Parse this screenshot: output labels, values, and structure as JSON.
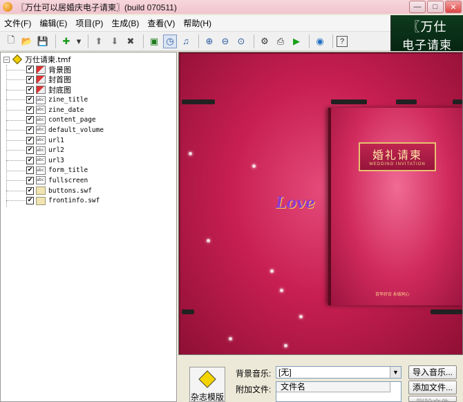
{
  "window": {
    "title": "〖万仕可以居婚庆电子请柬〗(build 070511)",
    "min_label": "—",
    "max_label": "□",
    "close_label": "✕"
  },
  "menu": [
    "文件(F)",
    "编辑(E)",
    "项目(P)",
    "生成(B)",
    "查看(V)",
    "帮助(H)"
  ],
  "brand": {
    "line1": "〖万仕",
    "line2": "电子请柬"
  },
  "toolbar": {
    "icons": [
      "new-file-icon",
      "open-folder-icon",
      "save-icon",
      "add-icon",
      "dropdown-icon",
      "move-up-icon",
      "move-down-icon",
      "delete-icon",
      "export-icon",
      "clock-icon",
      "music-icon",
      "zoom-in-icon",
      "zoom-out-icon",
      "zoom-fit-icon",
      "build-icon",
      "publish-icon",
      "play-icon",
      "web-icon",
      "help-icon"
    ],
    "glyphs": [
      "🗋",
      "📂",
      "💾",
      "✚",
      "▾",
      "⬆",
      "⬇",
      "✖",
      "▣",
      "◷",
      "♫",
      "⊕",
      "⊖",
      "⊙",
      "⚙",
      "⎙",
      "▶",
      "◉",
      "?"
    ]
  },
  "tree": {
    "root": "万仕请柬.tmf",
    "items": [
      {
        "label": "背景图",
        "type": "img",
        "zh": true
      },
      {
        "label": "封首图",
        "type": "img",
        "zh": true
      },
      {
        "label": "封底图",
        "type": "img",
        "zh": true
      },
      {
        "label": "zine_title",
        "type": "txt"
      },
      {
        "label": "zine_date",
        "type": "txt"
      },
      {
        "label": "content_page",
        "type": "txt"
      },
      {
        "label": "default_volume",
        "type": "txt"
      },
      {
        "label": "url1",
        "type": "txt"
      },
      {
        "label": "url2",
        "type": "txt"
      },
      {
        "label": "url3",
        "type": "txt"
      },
      {
        "label": "form_title",
        "type": "txt"
      },
      {
        "label": "fullscreen",
        "type": "txt"
      },
      {
        "label": "buttons.swf",
        "type": "swf"
      },
      {
        "label": "frontinfo.swf",
        "type": "swf"
      }
    ],
    "check_mark": "✔"
  },
  "preview": {
    "book_title_zh": "婚礼请柬",
    "book_title_en": "WEDDING INVITATION",
    "book_footer": "百年好合 永结同心",
    "love_text": "Love"
  },
  "bottom": {
    "magazine_label": "杂志模版",
    "bg_music_label": "背景音乐:",
    "bg_music_value": "[无]",
    "attach_label": "附加文件:",
    "filelist_header": "文件名",
    "import_music": "导入音乐...",
    "add_file": "添加文件...",
    "delete_file": "删除文件"
  },
  "colors": {
    "brand_bg": "#0e3b1d",
    "preview_bg": "#c81f52",
    "title_bar": "#f0c4ce"
  }
}
